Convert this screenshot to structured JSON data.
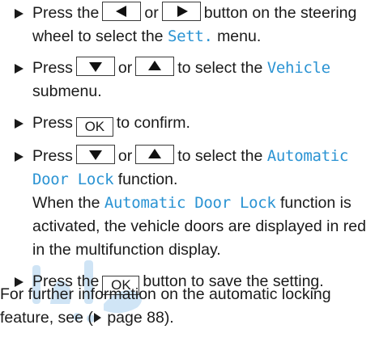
{
  "steps": [
    {
      "pre": "Press the",
      "or": "or",
      "post": "button on the steering wheel to select the",
      "menu": "Sett.",
      "end": "menu."
    },
    {
      "pre": "Press",
      "or": "or",
      "post": "to select the",
      "menu": "Vehicle",
      "end": "submenu."
    },
    {
      "pre": "Press",
      "key": "OK",
      "post": "to confirm."
    },
    {
      "pre": "Press",
      "or": "or",
      "post": "to select the",
      "func": "Automatic Door Lock",
      "end": "function.",
      "sub_pre": "When the",
      "sub_func": "Automatic Door Lock",
      "sub_post": "function is activated, the vehicle doors are displayed in red in the multifunction display."
    },
    {
      "pre": "Press the",
      "key": "OK",
      "post": "button to save the setting."
    }
  ],
  "note": {
    "text": "For further information on the automatic locking feature, see (",
    "page": "page 88)."
  },
  "colors": {
    "display_text": "#2a93d3",
    "watermark": "#a9cfee"
  },
  "icons": {
    "bullet": "triangle-right-icon",
    "keys": [
      "arrow-left-key",
      "arrow-right-key",
      "arrow-down-key",
      "arrow-up-key",
      "ok-key"
    ]
  }
}
